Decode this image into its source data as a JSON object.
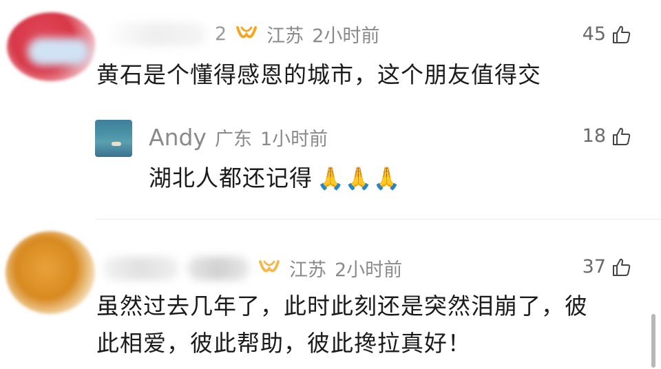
{
  "comments": [
    {
      "name_visible": "2",
      "location": "江苏",
      "time": "2小时前",
      "likes": "45",
      "text": "黄石是个懂得感恩的城市，这个朋友值得交",
      "reply": {
        "name": "Andy",
        "location": "广东",
        "time": "1小时前",
        "likes": "18",
        "text": "湖北人都还记得",
        "emoji": "🙏🙏🙏"
      }
    },
    {
      "location": "江苏",
      "time": "2小时前",
      "likes": "37",
      "text_line1": "虽然过去几年了，此时此刻还是突然泪崩了，彼",
      "text_line2": "此相爱，彼此帮助，彼此搀拉真好！"
    }
  ],
  "colors": {
    "meta_gray": "#8a8a8a",
    "vip_orange": "#f5a623",
    "divider": "#ececec"
  },
  "icons": {
    "vip": "vip-badge-icon",
    "like": "thumbs-up-icon"
  }
}
